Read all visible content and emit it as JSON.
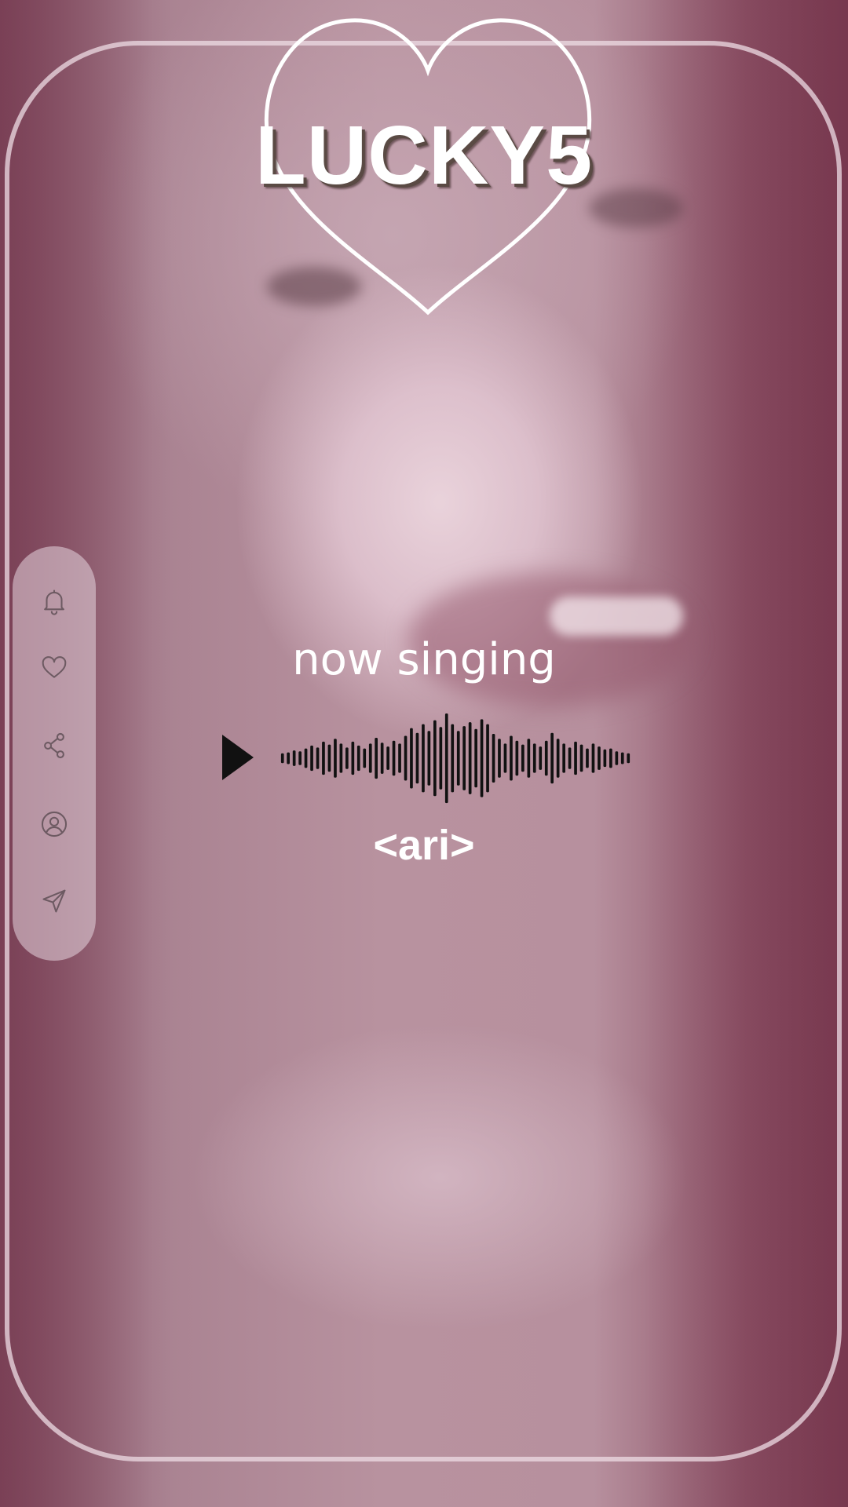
{
  "app": {
    "title": "LUCKY5"
  },
  "player": {
    "status_label": "now singing",
    "artist": "<ari>",
    "play_icon": "play-icon",
    "waveform_levels": [
      0.1,
      0.12,
      0.16,
      0.14,
      0.2,
      0.26,
      0.22,
      0.34,
      0.28,
      0.4,
      0.3,
      0.22,
      0.34,
      0.26,
      0.2,
      0.3,
      0.42,
      0.32,
      0.24,
      0.36,
      0.3,
      0.46,
      0.62,
      0.52,
      0.7,
      0.56,
      0.78,
      0.64,
      0.92,
      0.7,
      0.56,
      0.66,
      0.74,
      0.6,
      0.8,
      0.7,
      0.5,
      0.4,
      0.3,
      0.46,
      0.36,
      0.28,
      0.4,
      0.3,
      0.24,
      0.36,
      0.52,
      0.4,
      0.3,
      0.22,
      0.34,
      0.28,
      0.2,
      0.3,
      0.24,
      0.18,
      0.2,
      0.14,
      0.12,
      0.1
    ],
    "colors": {
      "wave": "#111111",
      "text": "#ffffff"
    }
  },
  "sidebar": {
    "items": [
      {
        "icon": "bell-icon",
        "label": "notifications"
      },
      {
        "icon": "heart-icon",
        "label": "like"
      },
      {
        "icon": "share-icon",
        "label": "share"
      },
      {
        "icon": "profile-icon",
        "label": "profile"
      },
      {
        "icon": "send-icon",
        "label": "send"
      }
    ]
  },
  "colors": {
    "frame": "#efdfe6",
    "accent": "#8a5666"
  }
}
